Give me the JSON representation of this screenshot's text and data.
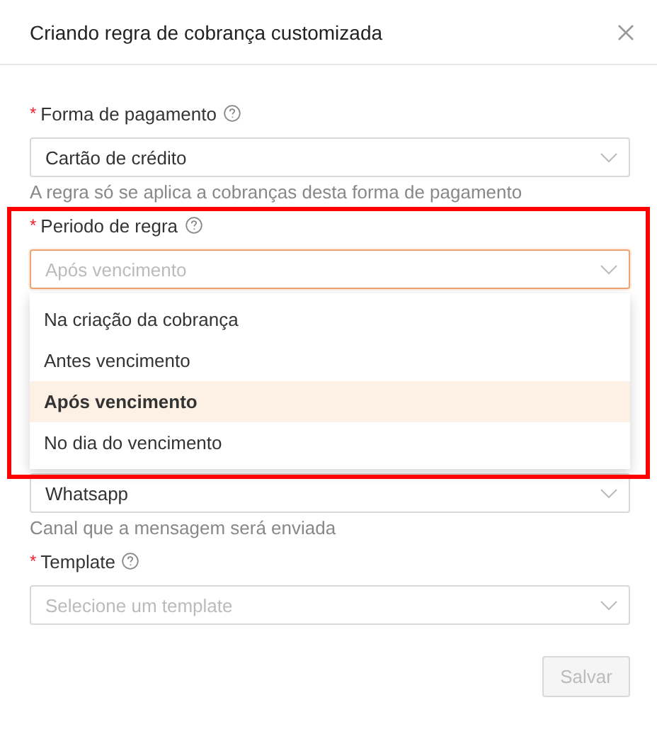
{
  "dialog": {
    "title": "Criando regra de cobrança customizada"
  },
  "fields": [
    {
      "kind": "select",
      "required_mark": "*",
      "label": "Forma de pagamento",
      "help": true,
      "value": "Cartão de crédito",
      "hint": "A regra só se aplica a cobranças desta forma de pagamento",
      "focused": false
    },
    {
      "kind": "select",
      "required_mark": "*",
      "label": "Periodo de regra",
      "help": true,
      "placeholder": "Após vencimento",
      "focused": true,
      "expanded": true,
      "options": [
        {
          "label": "Na criação da cobrança",
          "selected": false
        },
        {
          "label": "Antes vencimento",
          "selected": false
        },
        {
          "label": "Após vencimento",
          "selected": true
        },
        {
          "label": "No dia do vencimento",
          "selected": false
        }
      ]
    },
    {
      "kind": "covered-select",
      "value": "Whatsapp",
      "hint": "Canal que a mensagem será enviada",
      "focused": false
    },
    {
      "kind": "select",
      "required_mark": "*",
      "label": "Template",
      "help": true,
      "placeholder": "Selecione um template",
      "focused": false
    }
  ],
  "highlight": true,
  "save_button": {
    "label": "Salvar",
    "disabled": true
  }
}
